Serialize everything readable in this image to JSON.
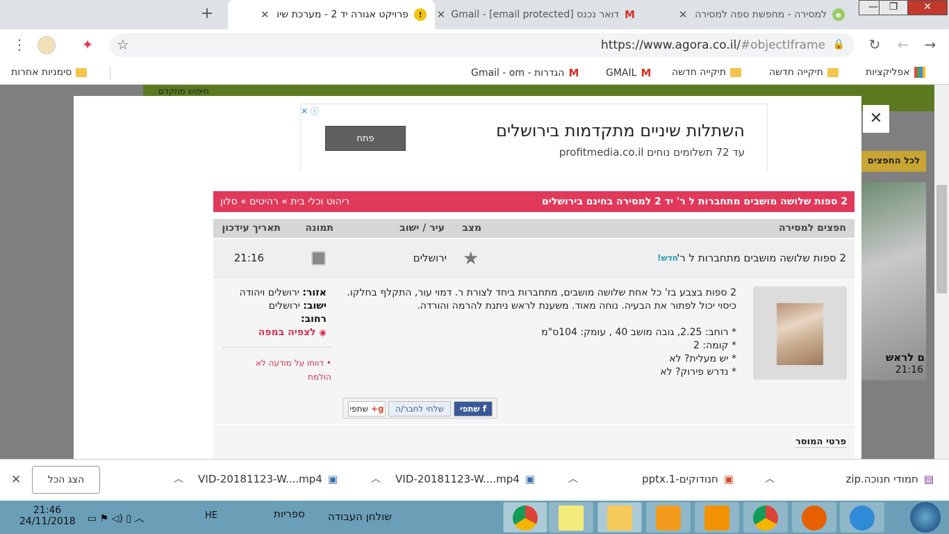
{
  "browser": {
    "tabs": [
      {
        "title": "למסירה - מחפשת ספה למסירה",
        "active": false
      },
      {
        "title": "דואר נכנס Gmail - [email protected]",
        "active": false
      },
      {
        "title": "פרויקט אגורה יד 2 - מערכת שיו",
        "active": true
      }
    ],
    "url_prefix": "https://www.agora.co.il/",
    "url_suffix": "#objectIframe",
    "bookmarks": [
      "אפליקציות",
      "תיקייה חדשה",
      "תיקייה חדשה",
      "GMAIL",
      "הגדרות - Gmail - om"
    ],
    "other_bookmarks": "סימניות אחרות"
  },
  "ad": {
    "title": "השתלות שיניים מתקדמות בירושלים",
    "subtitle": "עד 72 תשלומים נוחים profitmedia.co.il",
    "button": "פתח"
  },
  "listing": {
    "header_title": "2 ספות שלושה מושבים מתחברות ל ר' יד 2 למסירה בחינם בירושלים",
    "breadcrumb": "ריהוט וכלי בית » רהיטים » סלון",
    "columns": {
      "item": "חפצים למסירה",
      "state": "מצב",
      "city": "עיר / ישוב",
      "image": "תמונה",
      "updated": "תאריך עידכון"
    },
    "row": {
      "title": "2 ספות שלושה מושבים מתחברות ל ר'",
      "new_badge": "חדש!",
      "city": "ירושלים",
      "time": "21:16"
    },
    "description": [
      "2 ספות בצבע בז' כל אחת שלושה מושבים, מתחברות ביחד לצורת ר. דמוי עור, התקלף בחלקו.",
      "כיסוי יכול לפתור את הבעיה. נוחה מאוד. משענת לראש ניתנת להרמה והורדה.",
      "* רוחב: 2.25, גובה מושב 40 , עומק: 104ס\"מ",
      "* קומה: 2",
      "* יש מעלית? לא",
      "* נדרש פירוק? לא"
    ],
    "area_label": "אזור:",
    "area_value": "ירושלים ויהודה",
    "settlement_label": "ישוב:",
    "settlement_value": "ירושלים",
    "street_label": "רחוב:",
    "map_link": "לצפיה במפה",
    "report_link": "דווחו על מודעה לא הולמת",
    "share": {
      "facebook": "שתפי",
      "friend": "שלחי לחבר/ה",
      "google": "שתפי"
    },
    "seller_details": "פרטי המוסר"
  },
  "background": {
    "all_items": "לכל החפצים",
    "promo": "ם לראש",
    "promo_time": "21:16",
    "top_text": "חיפוש מתקדם"
  },
  "downloads": [
    {
      "name": "חמודי חנוכה.zip"
    },
    {
      "name": "חנודוקים-1.pptx"
    },
    {
      "name": "VID-20181123-W....mp4"
    },
    {
      "name": "VID-20181123-W....mp4"
    }
  ],
  "show_all": "הצג הכל",
  "taskbar": {
    "time": "21:46",
    "date": "24/11/2018",
    "lang": "HE",
    "libraries": "ספריות",
    "desktop": "שולחן העבודה"
  }
}
